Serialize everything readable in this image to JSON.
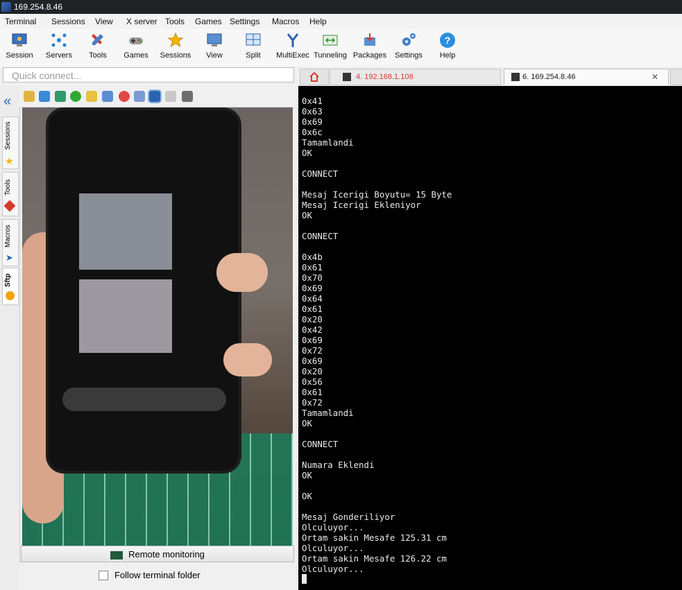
{
  "window": {
    "title": "169.254.8.46"
  },
  "menu": [
    "Terminal",
    "Sessions",
    "View",
    "X server",
    "Tools",
    "Games",
    "Settings",
    "Macros",
    "Help"
  ],
  "toolbar": [
    {
      "label": "Session",
      "icon": "session-monitor-icon"
    },
    {
      "label": "Servers",
      "icon": "servers-icon"
    },
    {
      "label": "Tools",
      "icon": "tools-icon"
    },
    {
      "label": "Games",
      "icon": "games-icon"
    },
    {
      "label": "Sessions",
      "icon": "star-icon"
    },
    {
      "label": "View",
      "icon": "view-icon"
    },
    {
      "label": "Split",
      "icon": "split-icon"
    },
    {
      "label": "MultiExec",
      "icon": "multiexec-icon"
    },
    {
      "label": "Tunneling",
      "icon": "tunneling-icon"
    },
    {
      "label": "Packages",
      "icon": "packages-icon"
    },
    {
      "label": "Settings",
      "icon": "gears-icon"
    },
    {
      "label": "Help",
      "icon": "help-icon"
    }
  ],
  "quick_connect": {
    "placeholder": "Quick connect..."
  },
  "tabs": [
    {
      "label": "4. 192.168.1.108",
      "color": "#d23b2a",
      "active": false
    },
    {
      "label": "6. 169.254.8.46",
      "color": "#1a1a1a",
      "active": true
    }
  ],
  "side_tabs": [
    "Sessions",
    "Tools",
    "Macros",
    "Sftp"
  ],
  "sftp": {
    "remote_monitoring": "Remote monitoring",
    "follow_folder": "Follow terminal folder",
    "follow_checked": false
  },
  "terminal": {
    "lines": [
      "0x41",
      "0x63",
      "0x69",
      "0x6c",
      "Tamamlandi",
      "OK",
      "",
      "CONNECT",
      "",
      "Mesaj Icerigi Boyutu= 15 Byte",
      "Mesaj Icerigi Ekleniyor",
      "OK",
      "",
      "CONNECT",
      "",
      "0x4b",
      "0x61",
      "0x70",
      "0x69",
      "0x64",
      "0x61",
      "0x20",
      "0x42",
      "0x69",
      "0x72",
      "0x69",
      "0x20",
      "0x56",
      "0x61",
      "0x72",
      "Tamamlandi",
      "OK",
      "",
      "CONNECT",
      "",
      "Numara Eklendi",
      "OK",
      "",
      "OK",
      "",
      "Mesaj Gonderiliyor",
      "Olculuyor...",
      "Ortam sakin Mesafe 125.31 cm",
      "Olculuyor...",
      "Ortam sakin Mesafe 126.22 cm",
      "Olculuyor..."
    ]
  }
}
